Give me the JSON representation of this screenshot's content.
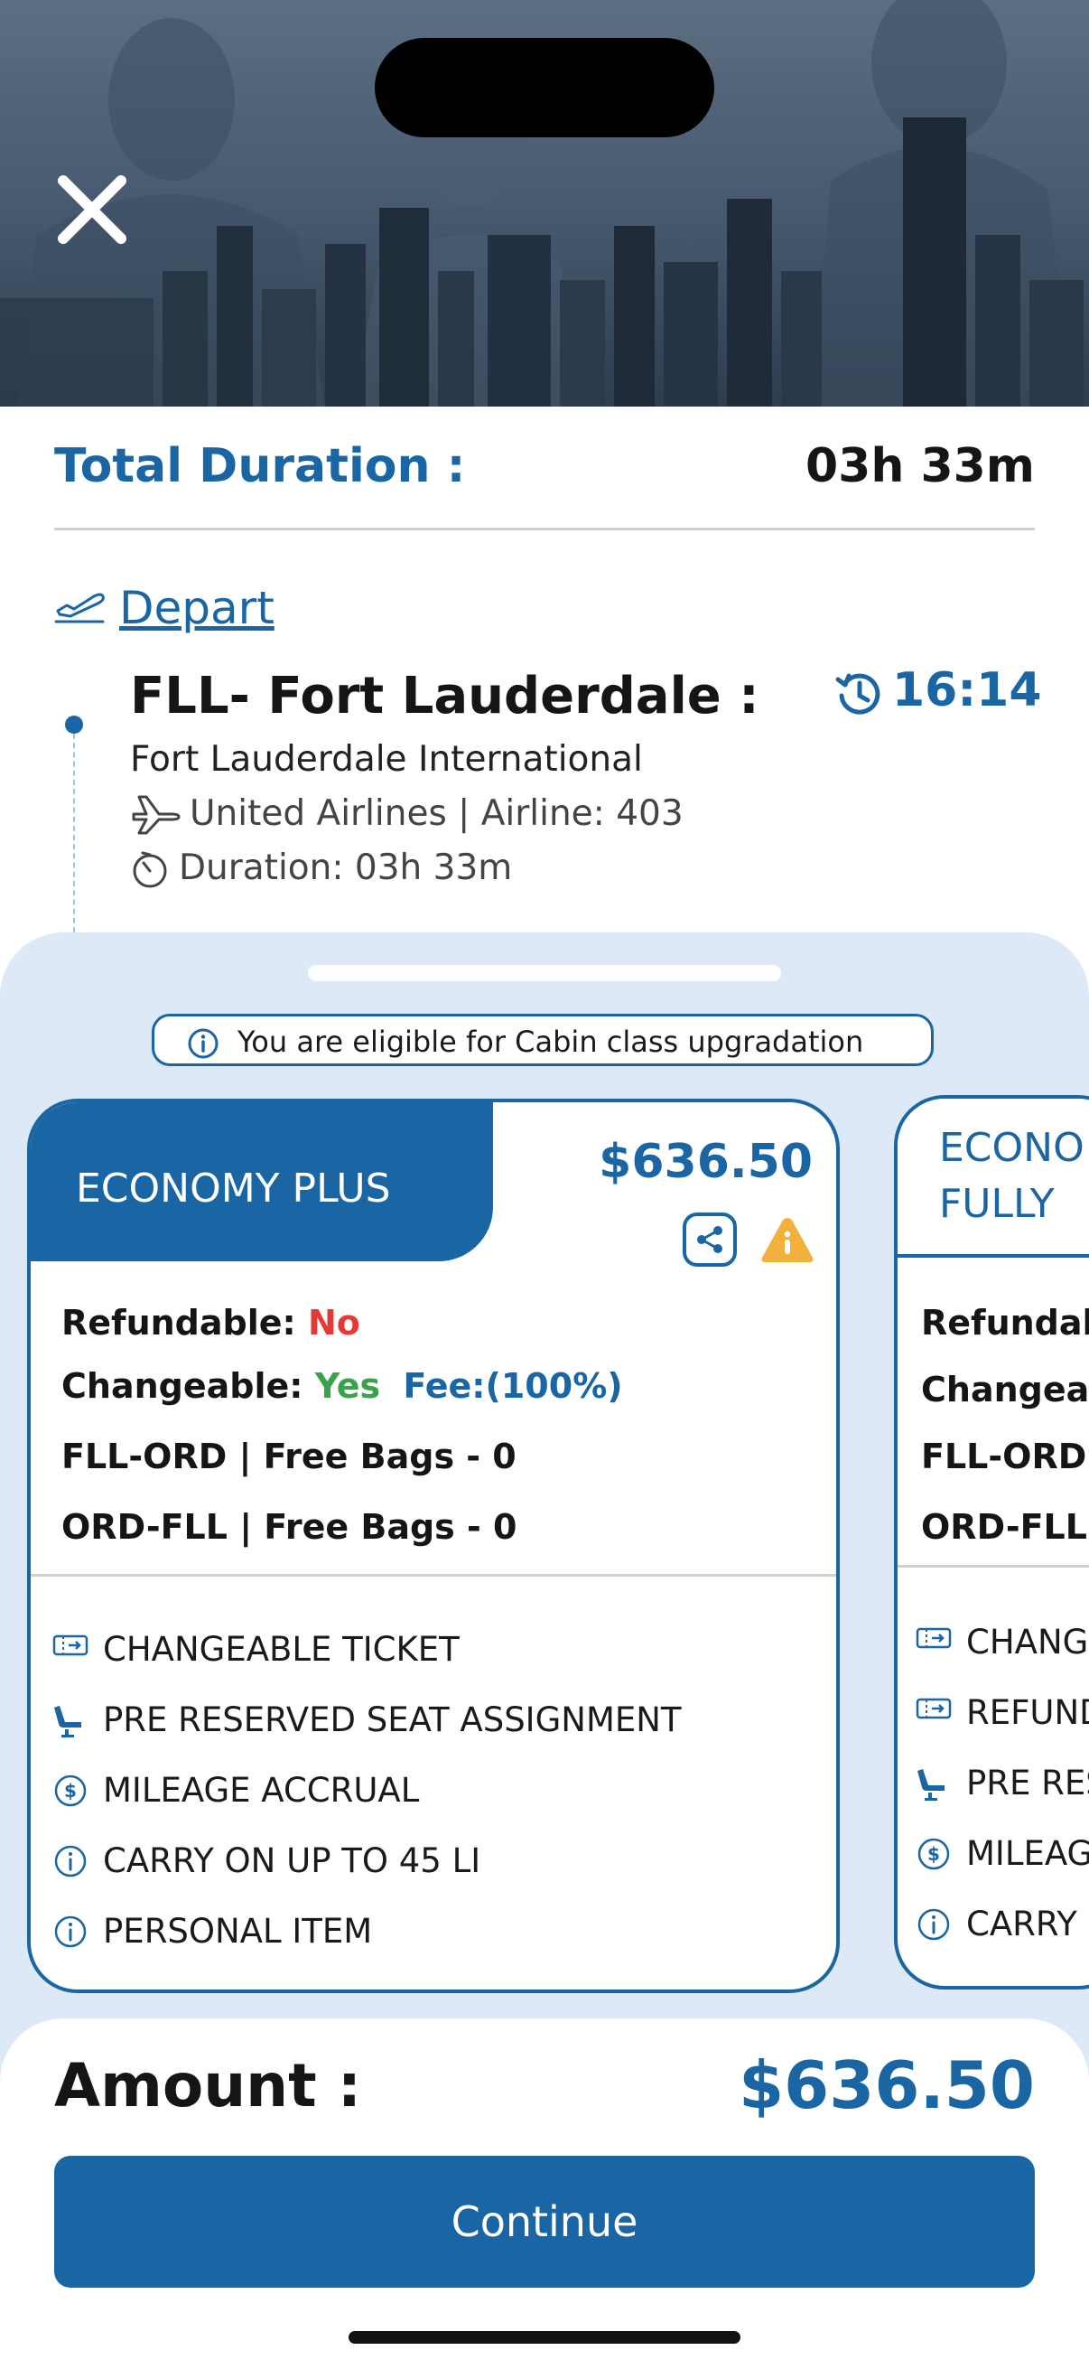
{
  "header": {
    "close_icon": "close-icon"
  },
  "summary": {
    "total_duration_label": "Total Duration :",
    "total_duration_value": "03h 33m",
    "depart_label": "Depart"
  },
  "segment": {
    "title": "FLL- Fort Lauderdale :",
    "time": "16:14",
    "airport": "Fort Lauderdale International",
    "airline": "United Airlines  | Airline: 403",
    "duration": "Duration: 03h 33m"
  },
  "upgrade_notice": "You are eligible for Cabin class upgradation",
  "fares": [
    {
      "name": "ECONOMY PLUS",
      "price": "$636.50",
      "refundable_label": "Refundable:",
      "refundable_value": "No",
      "changeable_label": "Changeable:",
      "changeable_value": "Yes",
      "change_fee": "Fee:(100%)",
      "bags": [
        "FLL-ORD | Free Bags - 0",
        "ORD-FLL | Free Bags - 0"
      ],
      "features": [
        {
          "icon": "ticket-icon",
          "label": "CHANGEABLE TICKET"
        },
        {
          "icon": "seat-icon",
          "label": "PRE RESERVED SEAT ASSIGNMENT"
        },
        {
          "icon": "dollar-icon",
          "label": "MILEAGE ACCRUAL"
        },
        {
          "icon": "info-icon",
          "label": "CARRY ON UP TO 45 LI"
        },
        {
          "icon": "info-icon",
          "label": "PERSONAL ITEM"
        }
      ]
    },
    {
      "name_line1": "ECONO",
      "name_line2": "FULLY",
      "lines": [
        "Refundab",
        "Changea",
        "FLL-ORD |",
        "ORD-FLL |"
      ],
      "features": [
        "CHANG",
        "REFUND",
        "PRE RES",
        "MILEAG",
        "CARRY"
      ]
    }
  ],
  "footer": {
    "amount_label": "Amount :",
    "amount_value": "$636.50",
    "continue_label": "Continue"
  },
  "colors": {
    "primary": "#1a65a3",
    "sheet_bg": "#dde9f7",
    "no_red": "#e53935",
    "yes_green": "#3aa24a",
    "warning": "#f2b13c"
  }
}
